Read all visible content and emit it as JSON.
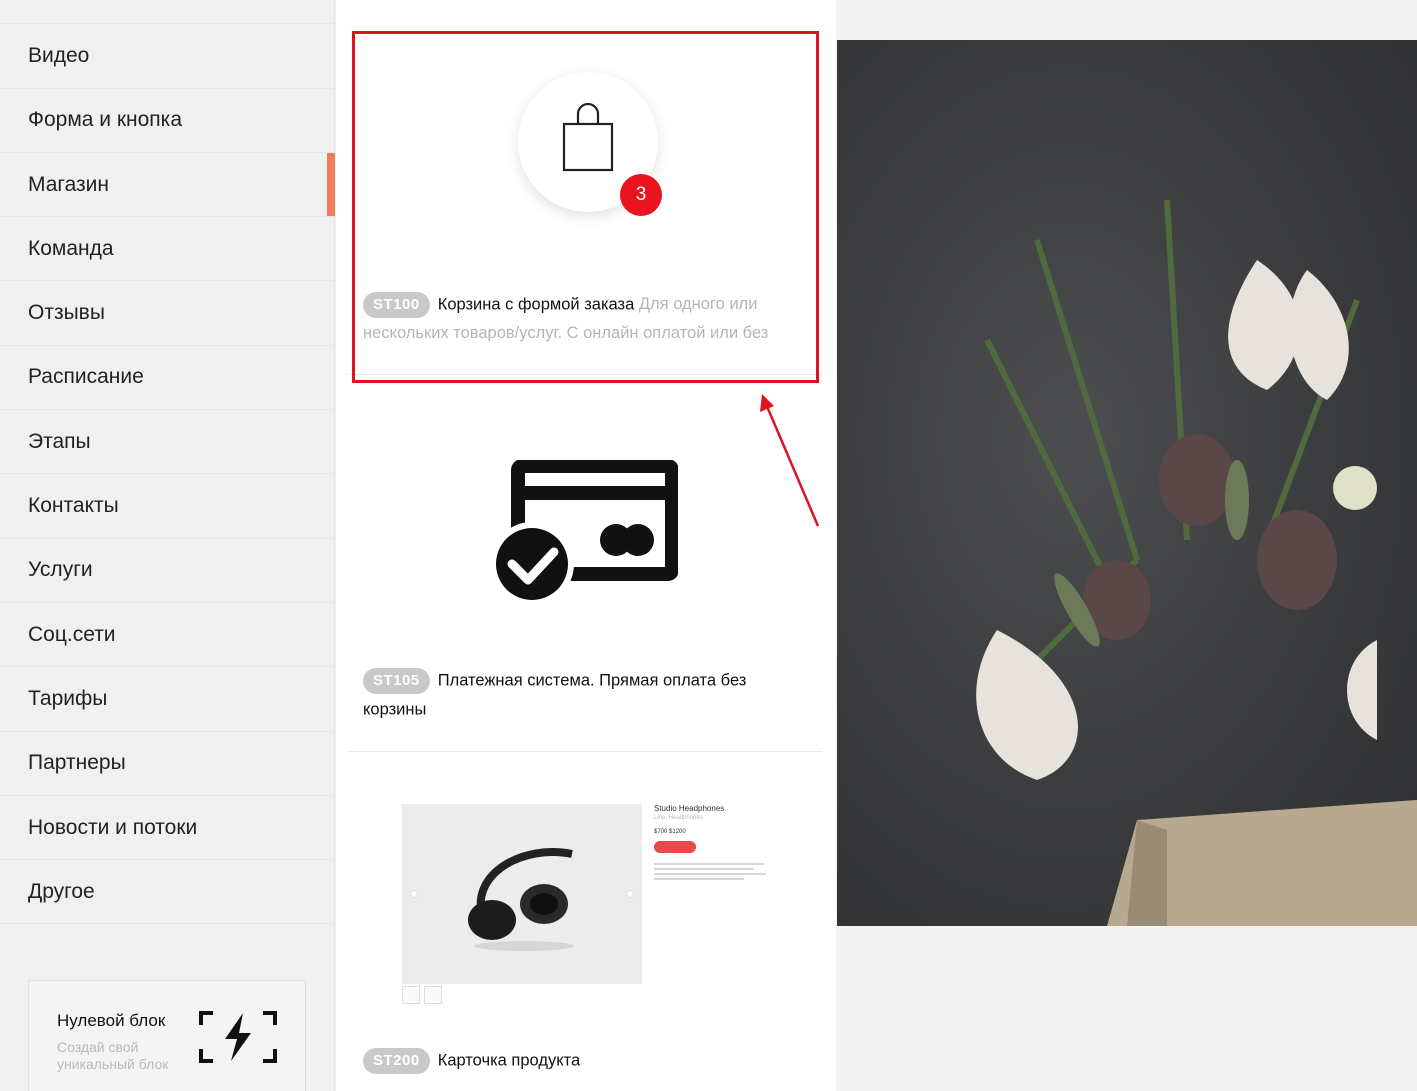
{
  "sidebar": {
    "items": [
      {
        "label": "Видео"
      },
      {
        "label": "Форма и кнопка"
      },
      {
        "label": "Магазин"
      },
      {
        "label": "Команда"
      },
      {
        "label": "Отзывы"
      },
      {
        "label": "Расписание"
      },
      {
        "label": "Этапы"
      },
      {
        "label": "Контакты"
      },
      {
        "label": "Услуги"
      },
      {
        "label": "Соц.сети"
      },
      {
        "label": "Тарифы"
      },
      {
        "label": "Партнеры"
      },
      {
        "label": "Новости и потоки"
      },
      {
        "label": "Другое"
      }
    ],
    "active_label": "Магазин",
    "zero_block": {
      "title": "Нулевой блок",
      "subtitle": "Создай свой уникальный блок"
    }
  },
  "blocks": [
    {
      "code": "ST100",
      "title": "Корзина с формой заказа",
      "description": "Для одного или нескольких товаров/услуг. С онлайн оплатой или без",
      "badge_count": "3"
    },
    {
      "code": "ST105",
      "title": "Платежная система. Прямая оплата без корзины",
      "description": ""
    },
    {
      "code": "ST200",
      "title": "Карточка продукта",
      "description": "",
      "preview": {
        "product_name": "Studio Headphones",
        "product_subtitle": "Line: Headphones",
        "price": "$700  $1200"
      }
    }
  ],
  "colors": {
    "accent": "#ef7d5a",
    "highlight": "#d9151e",
    "badge": "#e8131f",
    "code_badge": "#c9c9c9"
  },
  "icons": {
    "cart": "shopping-bag-icon",
    "payment": "payment-card-check-icon",
    "zero_block": "lightning-frame-icon"
  }
}
